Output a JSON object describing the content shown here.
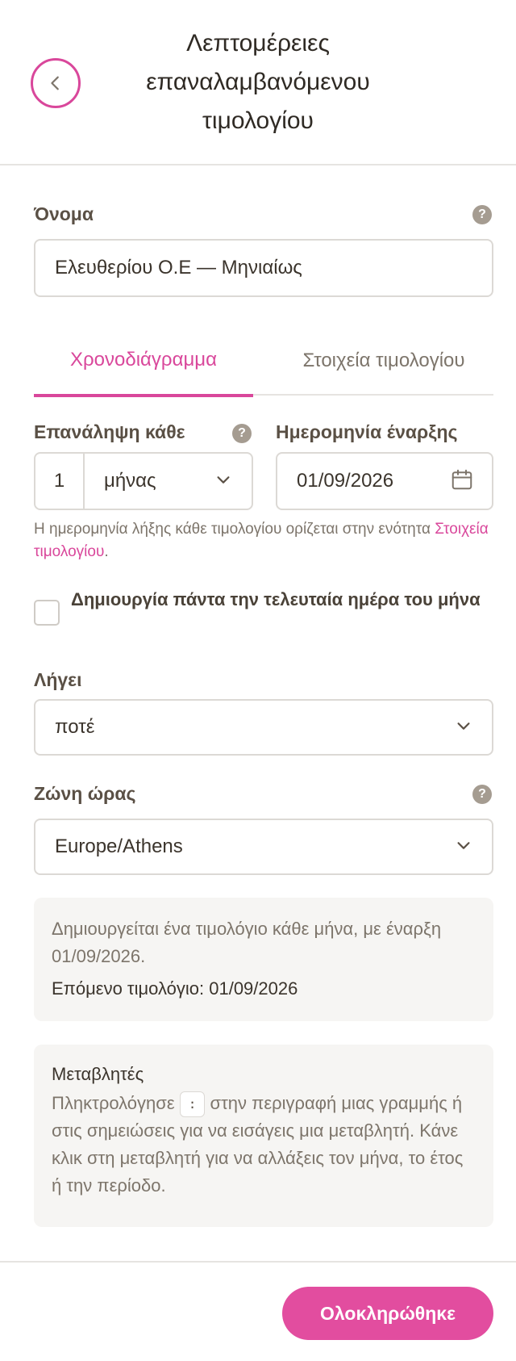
{
  "header": {
    "title_line1": "Λεπτομέρειες",
    "title_line2": "επαναλαμβανόμενου",
    "title_line3": "τιμολογίου"
  },
  "name_field": {
    "label": "Όνομα",
    "value": "Ελευθερίου Ο.Ε — Μηνιαίως"
  },
  "tabs": [
    {
      "label": "Χρονοδιάγραμμα",
      "active": true
    },
    {
      "label": "Στοιχεία τιμολογίου",
      "active": false
    }
  ],
  "repeat": {
    "label": "Επανάληψη κάθε",
    "count": "1",
    "unit": "μήνας"
  },
  "start_date": {
    "label": "Ημερομηνία έναρξης",
    "value": "01/09/2026"
  },
  "hint": {
    "text": "Η ημερομηνία λήξης κάθε τιμολογίου ορίζεται στην ενότητα ",
    "link": "Στοιχεία τιμολογίου",
    "suffix": "."
  },
  "last_day_checkbox": {
    "label": "Δημιουργία πάντα την τελευταία ημέρα του μήνα",
    "checked": false
  },
  "expires": {
    "label": "Λήγει",
    "value": "ποτέ"
  },
  "timezone": {
    "label": "Ζώνη ώρας",
    "value": "Europe/Athens"
  },
  "summary": {
    "text": "Δημιουργείται ένα τιμολόγιο κάθε μήνα, με έναρξη 01/09/2026.",
    "next": "Επόμενο τιμολόγιο: 01/09/2026"
  },
  "variables": {
    "title": "Μεταβλητές",
    "text_before": "Πληκτρολόγησε ",
    "key": ":",
    "text_after": " στην περιγραφή μιας γραμμής ή στις σημειώσεις για να εισάγεις μια μεταβλητή. Κάνε κλικ στη μεταβλητή για να αλλάξεις τον μήνα, το έτος ή την περίοδο."
  },
  "footer": {
    "done_label": "Ολοκληρώθηκε"
  },
  "colors": {
    "accent": "#d9479b",
    "button": "#e24d9f"
  }
}
